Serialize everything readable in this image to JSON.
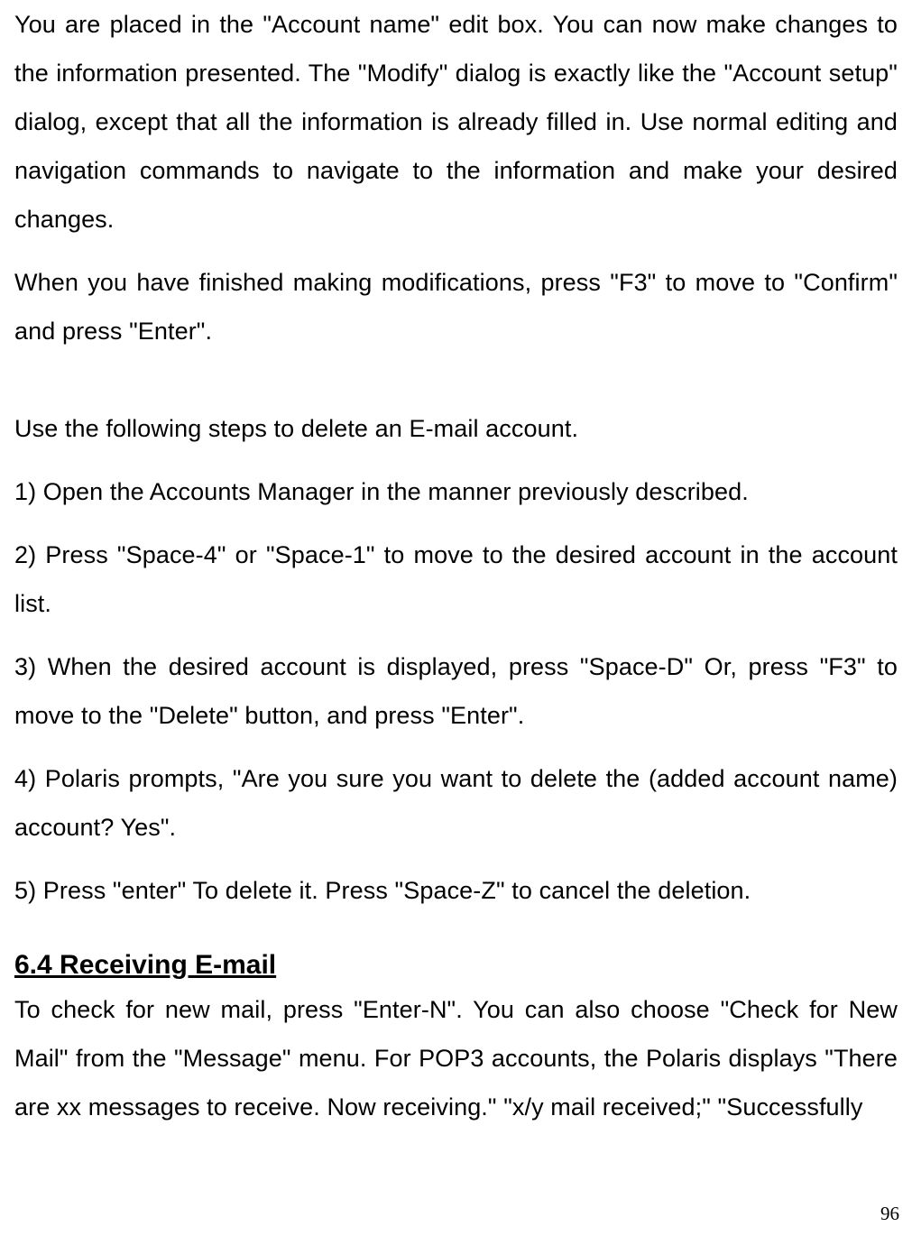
{
  "paragraphs": {
    "p1": "You are placed in the \"Account name\" edit box. You can now make changes to the information presented. The \"Modify\" dialog is exactly like the \"Account setup\" dialog, except that all the information is already filled in. Use normal editing and navigation commands to navigate to the information and make your desired changes.",
    "p2": "When you have finished making modifications, press \"F3\" to move to \"Confirm\" and press \"Enter\".",
    "p3": "Use the following steps to delete an E-mail account.",
    "step1": "1) Open the Accounts Manager in the manner previously described.",
    "step2": "2) Press \"Space-4\" or \"Space-1\" to move to the desired account in the account list.",
    "step3": "3) When the desired account is displayed, press \"Space-D\" Or, press \"F3\" to move to the \"Delete\" button, and press \"Enter\".",
    "step4": "4) Polaris prompts, \"Are you sure you want to delete the (added account name) account? Yes\".",
    "step5": "5) Press \"enter\" To delete it. Press \"Space-Z\" to cancel the deletion."
  },
  "section_heading": "6.4 Receiving E-mail",
  "section_body": "To check for new mail, press \"Enter-N\". You can also choose \"Check for New Mail\" from the \"Message\" menu. For POP3 accounts, the Polaris displays \"There are xx messages to receive. Now receiving.\" \"x/y mail received;\" \"Successfully",
  "page_number": "96"
}
